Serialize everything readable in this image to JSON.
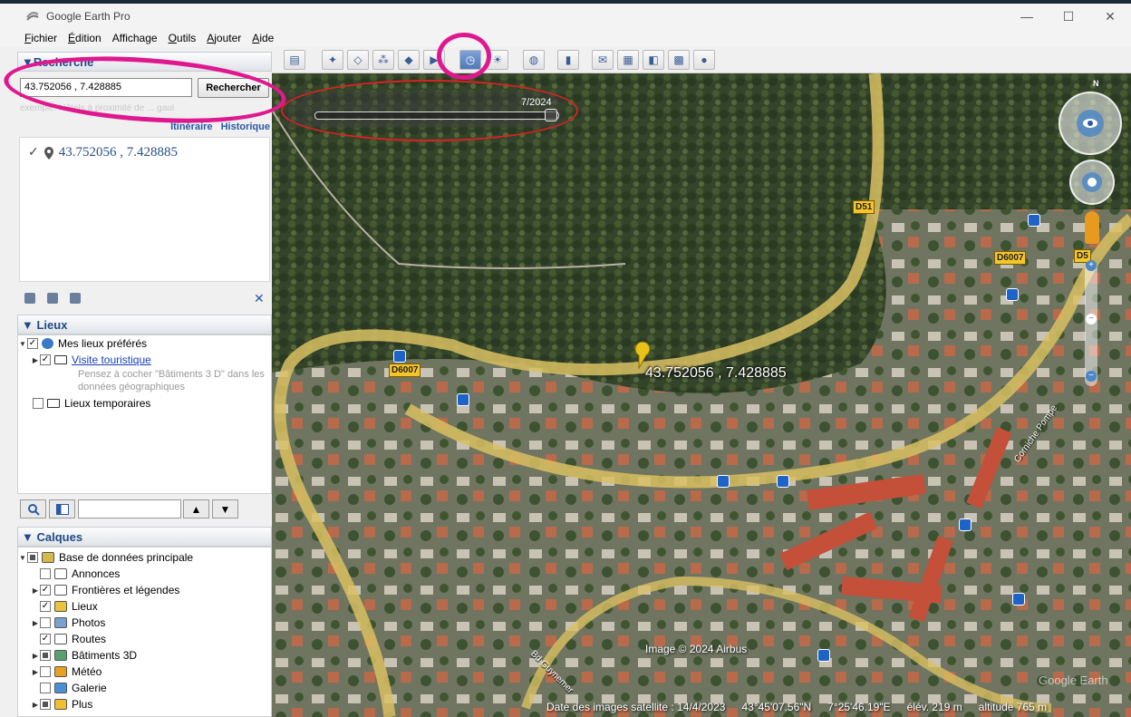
{
  "window": {
    "title": "Google Earth Pro",
    "min": "—",
    "max": "☐",
    "close": "✕"
  },
  "menu": {
    "fichier": "Fichier",
    "fichier_key": "F",
    "fichier_rest": "ichier",
    "edition": "Édition",
    "edition_key": "É",
    "edition_rest": "dition",
    "affichage": "Affichage",
    "outils": "Outils",
    "outils_key": "O",
    "outils_rest": "utils",
    "ajouter": "Ajouter",
    "ajouter_key": "A",
    "ajouter_rest": "jouter",
    "aide": "Aide",
    "aide_key": "A",
    "aide_rest": "ide"
  },
  "search": {
    "header": "▼Recherche",
    "value": "43.752056 , 7.428885",
    "button": "Rechercher",
    "hint": "exemple: Hôtels à proximité de ... gaul",
    "itineraire": "Itinéraire",
    "historique": "Historique",
    "result": "43.752056 , 7.428885"
  },
  "places": {
    "header": "▼ Lieux",
    "mes_lieux": "Mes lieux préférés",
    "visite": "Visite touristique",
    "visite_hint1": "Pensez à cocher \"Bâtiments 3 D\" dans les",
    "visite_hint2": "données géographiques",
    "temporaires": "Lieux temporaires"
  },
  "layers": {
    "header": "▼ Calques",
    "items": [
      {
        "label": "Base de données principale",
        "icon": "layers-icon",
        "state": "partial",
        "expand": true
      },
      {
        "label": "Annonces",
        "icon": "mail-icon",
        "state": "unchecked",
        "expand": false
      },
      {
        "label": "Frontières et légendes",
        "icon": "flag-icon",
        "state": "checked",
        "expand": true
      },
      {
        "label": "Lieux",
        "icon": "places-icon",
        "state": "checked",
        "expand": false
      },
      {
        "label": "Photos",
        "icon": "photo-icon",
        "state": "unchecked",
        "expand": true
      },
      {
        "label": "Routes",
        "icon": "road-icon",
        "state": "checked",
        "expand": false
      },
      {
        "label": "Bâtiments 3D",
        "icon": "building-icon",
        "state": "partial",
        "expand": true
      },
      {
        "label": "Météo",
        "icon": "weather-icon",
        "state": "unchecked",
        "expand": true
      },
      {
        "label": "Galerie",
        "icon": "gallery-icon",
        "state": "unchecked",
        "expand": false
      },
      {
        "label": "Plus",
        "icon": "more-icon",
        "state": "partial",
        "expand": true
      }
    ]
  },
  "toolbar": {
    "buttons": [
      "sidebar-icon",
      "placemark-icon",
      "polygon-icon",
      "path-icon",
      "overlay-icon",
      "tour-icon",
      "historical-imagery-icon",
      "sun-icon",
      "planet-icon",
      "ruler-icon",
      "email-icon",
      "print-icon",
      "save-image-icon",
      "map-icon",
      "earth-icon"
    ]
  },
  "map": {
    "time_label": "7/2024",
    "time_fraction": 1.0,
    "placemark_label": "43.752056 , 7.428885",
    "road_d51": "D51",
    "road_d6007": "D6007",
    "road_d6007b": "D6007",
    "road_d5": "D5",
    "street_label": "Bd Guynemer",
    "street_label2": "Corniche Pompe",
    "credits": "Image © 2024 Airbus",
    "watermark": "Google Earth",
    "north": "N",
    "status": {
      "date": "Date des images satellite : 14/4/2023",
      "lat": "43°45'07.56\"N",
      "lon": "7°25'46.19\"E",
      "elev": "élév.  219 m",
      "alt": "altitude   765 m"
    }
  }
}
